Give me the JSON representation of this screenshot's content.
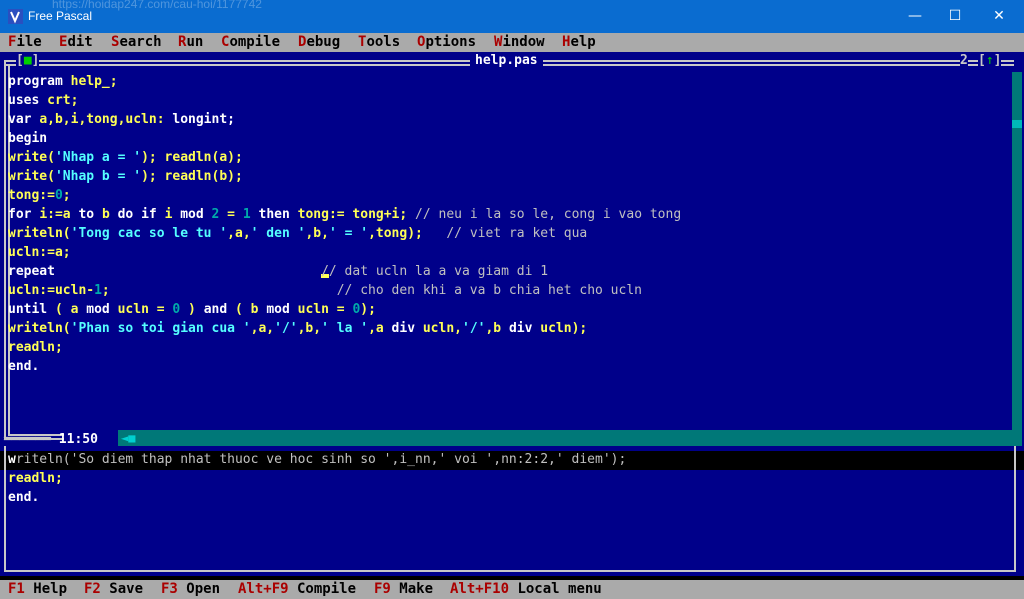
{
  "window": {
    "title": "Free Pascal",
    "ghost_url": "https://hoidap247.com/cau-hoi/1177742",
    "minimize": "—",
    "maximize": "☐",
    "close": "✕"
  },
  "menu": [
    {
      "hk": "F",
      "rest": "ile"
    },
    {
      "hk": "E",
      "rest": "dit"
    },
    {
      "hk": "S",
      "rest": "earch"
    },
    {
      "hk": "R",
      "rest": "un"
    },
    {
      "hk": "C",
      "rest": "ompile"
    },
    {
      "hk": "D",
      "rest": "ebug"
    },
    {
      "hk": "T",
      "rest": "ools"
    },
    {
      "hk": "O",
      "rest": "ptions"
    },
    {
      "hk": "W",
      "rest": "indow"
    },
    {
      "hk": "H",
      "rest": "elp"
    }
  ],
  "editor": {
    "close_box": "[■]",
    "filename": "help.pas",
    "window_number": "2",
    "zoom_box": "[↑]",
    "cursor_pos": "11:50"
  },
  "code_lines": [
    [
      [
        "w",
        "program "
      ],
      [
        "y",
        "help_;"
      ]
    ],
    [
      [
        "w",
        "uses "
      ],
      [
        "y",
        "crt;"
      ]
    ],
    [
      [
        "w",
        "var "
      ],
      [
        "y",
        "a,b,i,tong,ucln: "
      ],
      [
        "w",
        "longint;"
      ]
    ],
    [
      [
        "w",
        "begin"
      ]
    ],
    [
      [
        "y",
        "write("
      ],
      [
        "c",
        "'Nhap a = '"
      ],
      [
        "y",
        "); readln(a);"
      ]
    ],
    [
      [
        "y",
        "write("
      ],
      [
        "c",
        "'Nhap b = '"
      ],
      [
        "y",
        "); readln(b);"
      ]
    ],
    [
      [
        "y",
        "tong:="
      ],
      [
        "n",
        "0"
      ],
      [
        "y",
        ";"
      ]
    ],
    [
      [
        "w",
        "for "
      ],
      [
        "y",
        "i:=a "
      ],
      [
        "w",
        "to "
      ],
      [
        "y",
        "b "
      ],
      [
        "w",
        "do if "
      ],
      [
        "y",
        "i "
      ],
      [
        "w",
        "mod "
      ],
      [
        "n",
        "2"
      ],
      [
        "y",
        " = "
      ],
      [
        "n",
        "1"
      ],
      [
        "w",
        " then "
      ],
      [
        "y",
        "tong:= tong+i; "
      ],
      [
        "g",
        "// neu i la so le, cong i vao tong"
      ]
    ],
    [
      [
        "y",
        "writeln("
      ],
      [
        "c",
        "'Tong cac so le tu '"
      ],
      [
        "y",
        ",a,"
      ],
      [
        "c",
        "' den '"
      ],
      [
        "y",
        ",b,"
      ],
      [
        "c",
        "' = '"
      ],
      [
        "y",
        ",tong);   "
      ],
      [
        "g",
        "// viet ra ket qua"
      ]
    ],
    [
      [
        "y",
        "ucln:=a;"
      ]
    ],
    [
      [
        "w",
        "repeat                                  "
      ],
      [
        "cur",
        ""
      ],
      [
        "g",
        "// dat ucln la a va giam di 1"
      ]
    ],
    [
      [
        "y",
        "ucln:=ucln-"
      ],
      [
        "n",
        "1"
      ],
      [
        "y",
        ";                             "
      ],
      [
        "g",
        "// cho den khi a va b chia het cho ucln"
      ]
    ],
    [
      [
        "w",
        "until "
      ],
      [
        "y",
        "( a "
      ],
      [
        "w",
        "mod "
      ],
      [
        "y",
        "ucln = "
      ],
      [
        "n",
        "0"
      ],
      [
        "y",
        " ) "
      ],
      [
        "w",
        "and "
      ],
      [
        "y",
        "( b "
      ],
      [
        "w",
        "mod "
      ],
      [
        "y",
        "ucln = "
      ],
      [
        "n",
        "0"
      ],
      [
        "y",
        ");"
      ]
    ],
    [
      [
        "y",
        "writeln("
      ],
      [
        "c",
        "'Phan so toi gian cua '"
      ],
      [
        "y",
        ",a,"
      ],
      [
        "c",
        "'/'"
      ],
      [
        "y",
        ",b,"
      ],
      [
        "c",
        "' la '"
      ],
      [
        "y",
        ",a "
      ],
      [
        "w",
        "div "
      ],
      [
        "y",
        "ucln,"
      ],
      [
        "c",
        "'/'"
      ],
      [
        "y",
        ",b "
      ],
      [
        "w",
        "div "
      ],
      [
        "y",
        "ucln);"
      ]
    ],
    [
      [
        "y",
        "readln;"
      ]
    ],
    [
      [
        "w",
        "end."
      ]
    ]
  ],
  "lower_lines": [
    [
      [
        "w",
        "w"
      ],
      [
        "hlgrey",
        "riteln('So diem thap nhat thuoc ve hoc sinh so ',i_nn,' voi ',nn:2:2,' diem');"
      ]
    ],
    [
      [
        "y",
        "readln;"
      ]
    ],
    [
      [
        "w",
        "end."
      ]
    ]
  ],
  "fkeys": [
    {
      "key": "F1",
      "label": " Help"
    },
    {
      "key": "F2",
      "label": " Save"
    },
    {
      "key": "F3",
      "label": " Open"
    },
    {
      "key": "Alt+F9",
      "label": " Compile"
    },
    {
      "key": "F9",
      "label": " Make"
    },
    {
      "key": "Alt+F10",
      "label": " Local menu"
    }
  ],
  "colors": {
    "editor_bg": "#00008a",
    "keyword": "#ffffff",
    "identifier": "#ffff55",
    "string": "#55ffff",
    "comment": "#c0c0c0",
    "number": "#00aaaa"
  }
}
